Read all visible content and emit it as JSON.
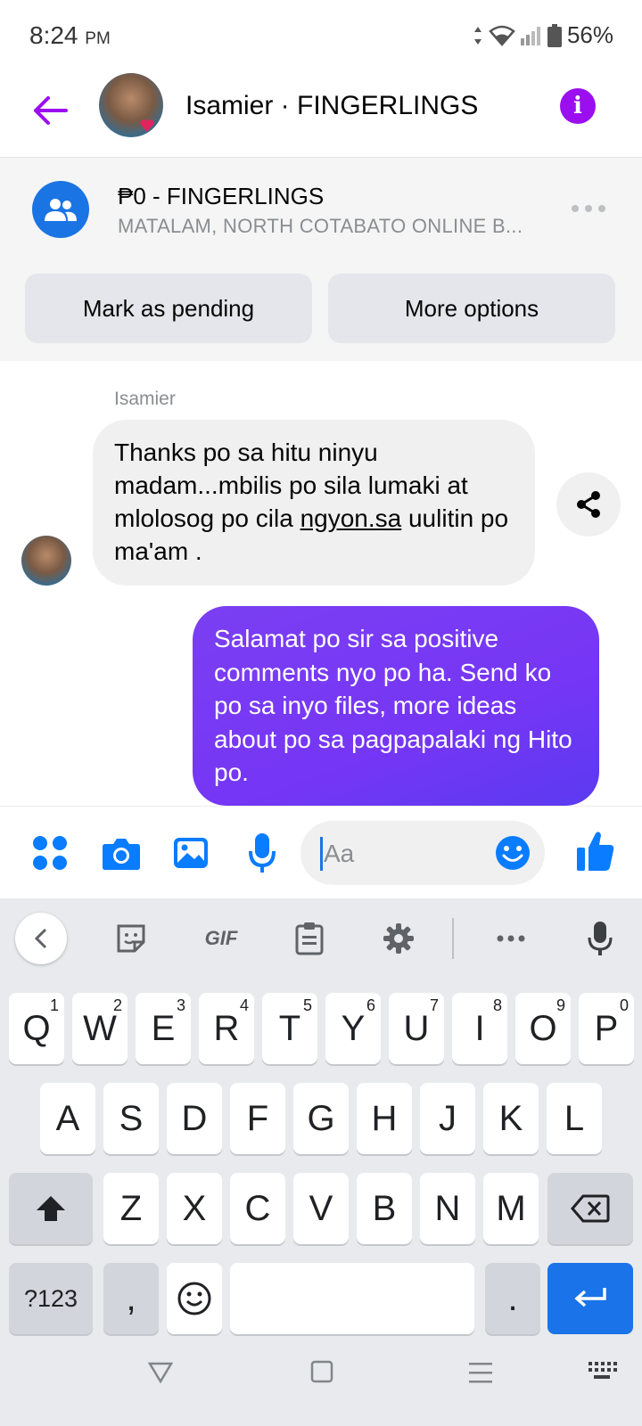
{
  "status_bar": {
    "time": "8:24",
    "ampm": "PM",
    "battery": "56%"
  },
  "header": {
    "title": "Isamier · FINGERLINGS"
  },
  "listing": {
    "title": "₱0 - FINGERLINGS",
    "subtitle": "MATALAM, NORTH COTABATO ONLINE B...",
    "mark_pending": "Mark as pending",
    "more_options": "More options"
  },
  "messages": {
    "sender": "Isamier",
    "incoming_1": "Thanks po sa hitu ninyu madam...mbilis po sila lumaki at mlolosog po cila ",
    "incoming_link": "ngyon.sa",
    "incoming_2": " uulitin po ma'am .",
    "outgoing": "Salamat po sir sa positive comments nyo po ha. Send ko po sa inyo files, more ideas about po sa pagpapalaki ng Hito po."
  },
  "composer": {
    "placeholder": "Aa"
  },
  "keyboard": {
    "toolbar": {
      "gif": "GIF"
    },
    "row1": [
      {
        "k": "Q",
        "n": "1"
      },
      {
        "k": "W",
        "n": "2"
      },
      {
        "k": "E",
        "n": "3"
      },
      {
        "k": "R",
        "n": "4"
      },
      {
        "k": "T",
        "n": "5"
      },
      {
        "k": "Y",
        "n": "6"
      },
      {
        "k": "U",
        "n": "7"
      },
      {
        "k": "I",
        "n": "8"
      },
      {
        "k": "O",
        "n": "9"
      },
      {
        "k": "P",
        "n": "0"
      }
    ],
    "row2": [
      "A",
      "S",
      "D",
      "F",
      "G",
      "H",
      "J",
      "K",
      "L"
    ],
    "row3": [
      "Z",
      "X",
      "C",
      "V",
      "B",
      "N",
      "M"
    ],
    "symbols": "?123",
    "comma": ",",
    "period": "."
  },
  "colors": {
    "accent_purple": "#9b0ef0",
    "messenger_blue": "#0a7cff",
    "keyboard_bg": "#e8eaed",
    "enter_blue": "#1a73e8"
  }
}
